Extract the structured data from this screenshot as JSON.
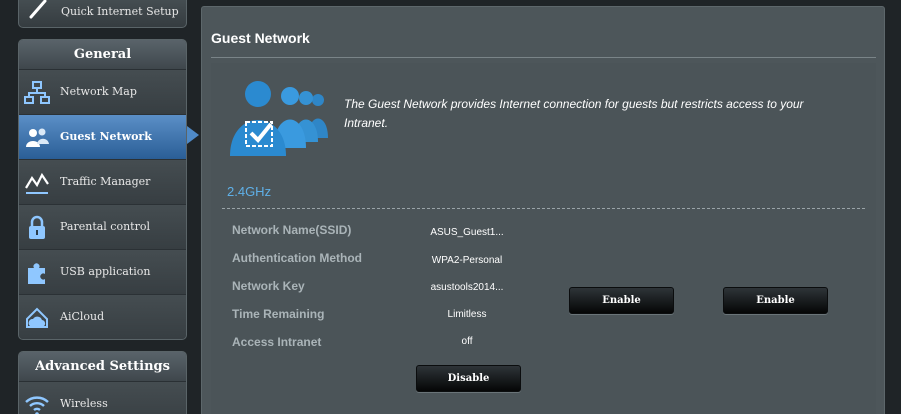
{
  "sidebar": {
    "quick_setup": "Quick Internet Setup",
    "general_header": "General",
    "general_items": [
      {
        "label": "Network Map",
        "icon": "network-map-icon"
      },
      {
        "label": "Guest Network",
        "icon": "guest-network-icon",
        "active": true
      },
      {
        "label": "Traffic Manager",
        "icon": "traffic-manager-icon"
      },
      {
        "label": "Parental control",
        "icon": "lock-icon"
      },
      {
        "label": "USB application",
        "icon": "puzzle-icon"
      },
      {
        "label": "AiCloud",
        "icon": "cloud-icon"
      }
    ],
    "advanced_header": "Advanced Settings",
    "advanced_items": [
      {
        "label": "Wireless",
        "icon": "wifi-icon"
      }
    ]
  },
  "main": {
    "title": "Guest Network",
    "description": "The Guest Network provides Internet connection for guests but restricts access to your Intranet.",
    "band": "2.4GHz",
    "fields": {
      "ssid": {
        "label": "Network Name(SSID)",
        "value": "ASUS_Guest1..."
      },
      "auth": {
        "label": "Authentication Method",
        "value": "WPA2-Personal"
      },
      "key": {
        "label": "Network Key",
        "value": "asustools2014..."
      },
      "time": {
        "label": "Time Remaining",
        "value": "Limitless"
      },
      "intranet": {
        "label": "Access Intranet",
        "value": "off"
      }
    },
    "buttons": {
      "disable": "Disable",
      "enable_2": "Enable",
      "enable_3": "Enable"
    }
  },
  "colors": {
    "accent": "#5fb0e8",
    "active_menu": "#2a5e96",
    "panel": "#4d565a"
  }
}
